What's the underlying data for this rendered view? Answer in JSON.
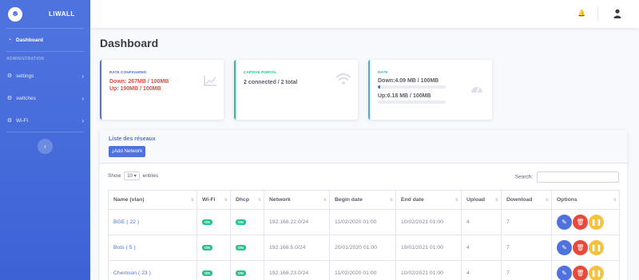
{
  "brand": {
    "name": "LIWALL",
    "logo_glyph": "☻"
  },
  "sidebar": {
    "dashboard": {
      "label": "Dashboard",
      "icon": "tachometer-icon"
    },
    "heading": "ADMINISTRATION",
    "items": [
      {
        "label": "settings",
        "icon": "gear-icon"
      },
      {
        "label": "switches",
        "icon": "gear-icon"
      },
      {
        "label": "Wi-Fi",
        "icon": "gear-icon"
      }
    ],
    "toggle_glyph": "‹"
  },
  "topbar": {
    "bell_icon": "bell-icon",
    "avatar_icon": "user-avatar-icon"
  },
  "page": {
    "title": "Dashboard"
  },
  "cards": {
    "rate_configured": {
      "title": "RATE CONFIGURED",
      "down": "Down: 267MB / 100MB",
      "up": "Up: 190MB / 100MB",
      "icon": "chart-area-icon"
    },
    "captive_portal": {
      "title": "CAPTIVE PORTAL",
      "value": "2 connected / 2 total",
      "icon": "wifi-icon"
    },
    "rate": {
      "title": "RATE",
      "down": "Down:4.09 MB / 100MB",
      "down_fraction": 0.04,
      "up": "Up:0.18 MB / 100MB",
      "up_fraction": 0.0,
      "icon": "gauge-icon"
    }
  },
  "networks": {
    "title": "Liste des réseaux",
    "add_label": "Add Network",
    "show_label": "Show",
    "page_size": "10",
    "entries_label": "entries",
    "search_label": "Search:",
    "search_value": "",
    "columns": [
      "Name (vlan)",
      "Wi-Fi",
      "Dhcp",
      "Network",
      "Begin date",
      "End date",
      "Upload",
      "Download",
      "Options"
    ],
    "rows": [
      {
        "name": "BGE",
        "vlan": "( 22 )",
        "wifi": "ON",
        "dhcp": "ON",
        "network": "192.168.22.0/24",
        "begin": "11/02/2020 01:00",
        "end": "10/02/2021 01:00",
        "upload": "4",
        "download": "7"
      },
      {
        "name": "Bots",
        "vlan": "( 5 )",
        "wifi": "ON",
        "dhcp": "ON",
        "network": "192.168.5.0/24",
        "begin": "20/01/2020 01:00",
        "end": "19/01/2021 01:00",
        "upload": "4",
        "download": "7"
      },
      {
        "name": "Chemson",
        "vlan": "( 23 )",
        "wifi": "ON",
        "dhcp": "ON",
        "network": "192.168.23.0/24",
        "begin": "11/02/2020 01:00",
        "end": "10/02/2021 01:00",
        "upload": "4",
        "download": "7"
      }
    ]
  },
  "colors": {
    "primary": "#4e73df",
    "success": "#1cc88a",
    "info": "#36b9cc",
    "danger": "#e74a3b",
    "warning": "#f6c23e"
  }
}
